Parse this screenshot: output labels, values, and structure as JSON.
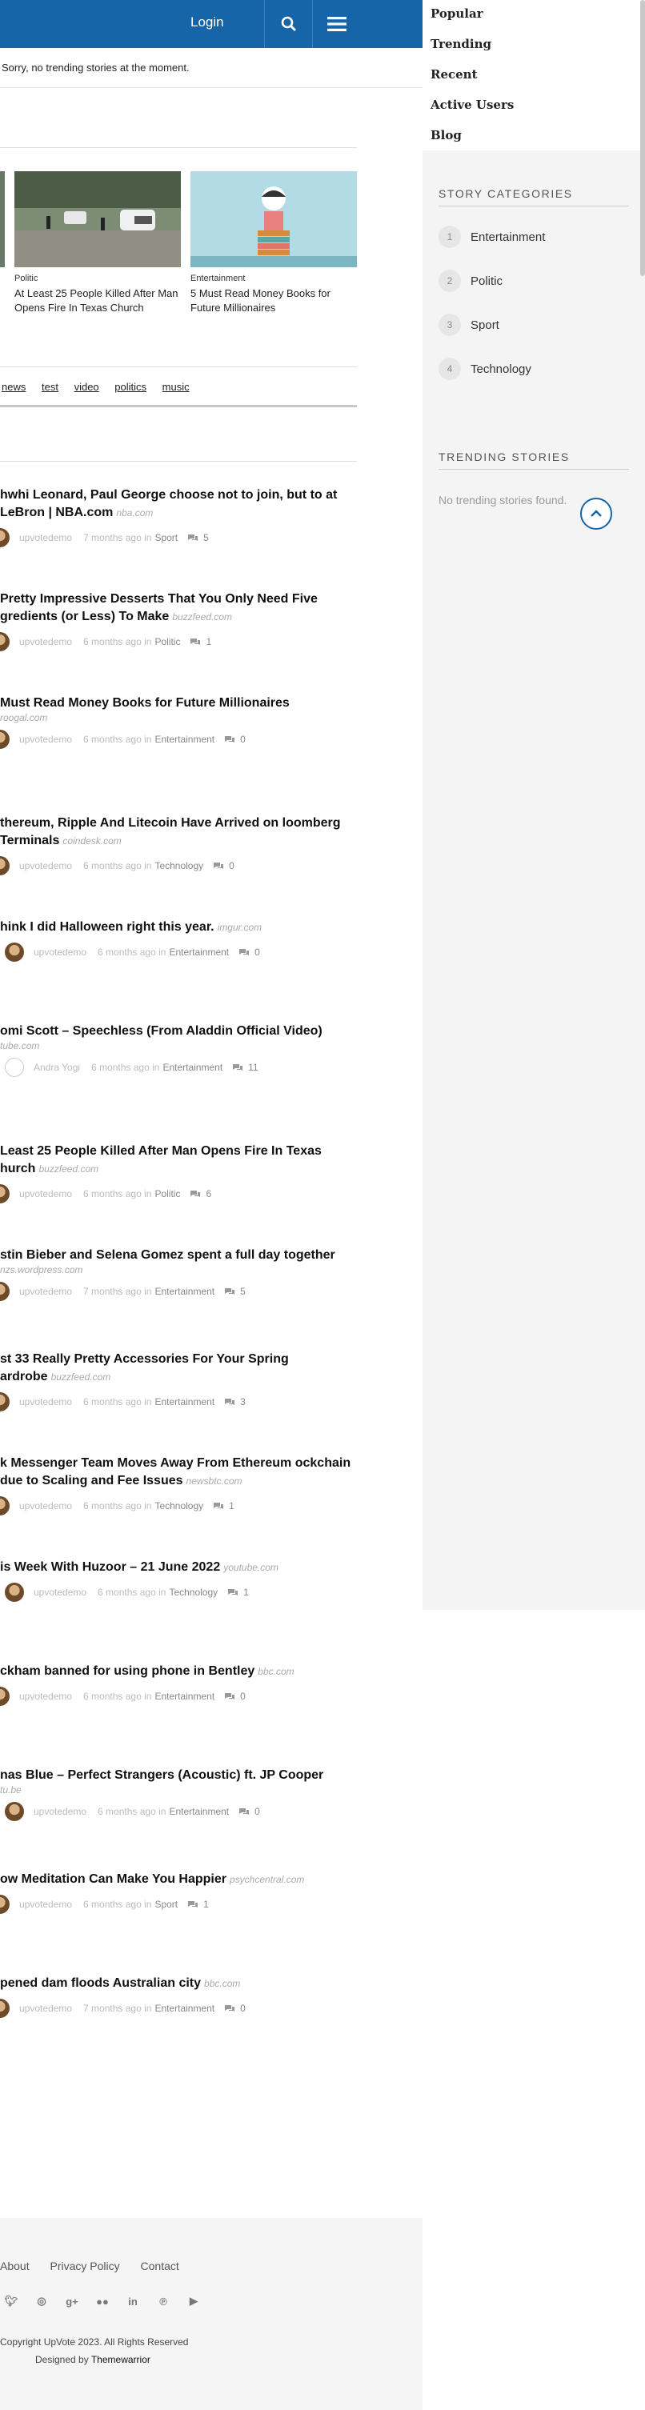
{
  "header": {
    "login_label": "Login",
    "search_icon": "search-icon",
    "menu_icon": "hamburger-menu-icon",
    "brand_color": "#1565a8"
  },
  "notice": "Sorry, no trending stories at the moment.",
  "menu": [
    "Popular",
    "Trending",
    "Recent",
    "Active Users",
    "Blog"
  ],
  "slider": [
    {
      "category": "Politic",
      "title": "At Least 25 People Killed After Man Opens Fire In Texas Church"
    },
    {
      "category": "Entertainment",
      "title": "5 Must Read Money Books for Future Millionaires"
    }
  ],
  "tags": [
    "news",
    "test",
    "video",
    "politics",
    "music"
  ],
  "stories": [
    {
      "title": "hwhi Leonard, Paul George choose not to join, but to at LeBron | NBA.com",
      "domain": "nba.com",
      "author": "upvotedemo",
      "time": "7 months ago in",
      "category": "Sport",
      "comments": "5"
    },
    {
      "title": "Pretty Impressive Desserts That You Only Need Five gredients (or Less) To Make",
      "domain": "buzzfeed.com",
      "author": "upvotedemo",
      "time": "6 months ago in",
      "category": "Politic",
      "comments": "1"
    },
    {
      "title": "Must Read Money Books for Future Millionaires",
      "domain": "roogal.com",
      "author": "upvotedemo",
      "time": "6 months ago in",
      "category": "Entertainment",
      "comments": "0"
    },
    {
      "title": "thereum, Ripple And Litecoin Have Arrived on loomberg Terminals",
      "domain": "coindesk.com",
      "author": "upvotedemo",
      "time": "6 months ago in",
      "category": "Technology",
      "comments": "0"
    },
    {
      "title": "hink I did Halloween right this year.",
      "domain": "imgur.com",
      "author": "upvotedemo",
      "time": "6 months ago in",
      "category": "Entertainment",
      "comments": "0"
    },
    {
      "title": "omi Scott – Speechless (From Aladdin Official Video)",
      "domain": "tube.com",
      "author": "Andra Yogi",
      "time": "6 months ago in",
      "category": "Entertainment",
      "comments": "11"
    },
    {
      "title": "Least 25 People Killed After Man Opens Fire In Texas hurch",
      "domain": "buzzfeed.com",
      "author": "upvotedemo",
      "time": "6 months ago in",
      "category": "Politic",
      "comments": "6"
    },
    {
      "title": "stin Bieber and Selena Gomez spent a full day together",
      "domain": "nzs.wordpress.com",
      "author": "upvotedemo",
      "time": "7 months ago in",
      "category": "Entertainment",
      "comments": "5"
    },
    {
      "title": "st 33 Really Pretty Accessories For Your Spring ardrobe",
      "domain": "buzzfeed.com",
      "author": "upvotedemo",
      "time": "6 months ago in",
      "category": "Entertainment",
      "comments": "3"
    },
    {
      "title": "k Messenger Team Moves Away From Ethereum ockchain due to Scaling and Fee Issues",
      "domain": "newsbtc.com",
      "author": "upvotedemo",
      "time": "6 months ago in",
      "category": "Technology",
      "comments": "1"
    },
    {
      "title": "is Week With Huzoor – 21 June 2022",
      "domain": "youtube.com",
      "author": "upvotedemo",
      "time": "6 months ago in",
      "category": "Technology",
      "comments": "1"
    },
    {
      "title": "ckham banned for using phone in Bentley",
      "domain": "bbc.com",
      "author": "upvotedemo",
      "time": "6 months ago in",
      "category": "Entertainment",
      "comments": "0"
    },
    {
      "title": "nas Blue – Perfect Strangers (Acoustic) ft. JP Cooper",
      "domain": "tu.be",
      "author": "upvotedemo",
      "time": "6 months ago in",
      "category": "Entertainment",
      "comments": "0"
    },
    {
      "title": "ow Meditation Can Make You Happier",
      "domain": "psychcentral.com",
      "author": "upvotedemo",
      "time": "6 months ago in",
      "category": "Sport",
      "comments": "1"
    },
    {
      "title": "pened dam floods Australian city",
      "domain": "bbc.com",
      "author": "upvotedemo",
      "time": "7 months ago in",
      "category": "Entertainment",
      "comments": "0"
    }
  ],
  "sidebar": {
    "categories_heading": "STORY CATEGORIES",
    "categories": [
      {
        "num": "1",
        "label": "Entertainment"
      },
      {
        "num": "2",
        "label": "Politic"
      },
      {
        "num": "3",
        "label": "Sport"
      },
      {
        "num": "4",
        "label": "Technology"
      }
    ],
    "trending_heading": "TRENDING STORIES",
    "no_trending": "No trending stories found."
  },
  "footer": {
    "links": [
      "About",
      "Privacy Policy",
      "Contact"
    ],
    "socials": [
      "twitter-icon",
      "instagram-icon",
      "google-plus-icon",
      "flickr-icon",
      "linkedin-icon",
      "pinterest-icon",
      "youtube-icon"
    ],
    "copyright": "Copyright UpVote 2023. All Rights Reserved",
    "designed_prefix": "Designed by",
    "designed_by": "Themewarrior"
  }
}
